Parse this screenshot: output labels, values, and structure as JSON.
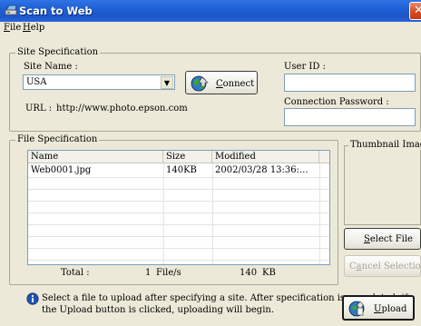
{
  "window": {
    "title": "Scan to Web"
  },
  "menu": [
    {
      "label": "File",
      "accel": "F",
      "rest": "ile"
    },
    {
      "label": "Help",
      "accel": "H",
      "rest": "elp"
    }
  ],
  "site": {
    "group_label": "Site Specification",
    "site_name_label": "Site Name :",
    "site_name_value": "USA",
    "connect_label": "Connect",
    "connect_accel": "C",
    "connect_rest": "onnect",
    "url_label": "URL :",
    "url_value": "http://www.photo.epson.com",
    "user_id_label": "User ID :",
    "password_label": "Connection Password :"
  },
  "files": {
    "group_label": "File Specification",
    "columns": [
      "Name",
      "Size",
      "Modified"
    ],
    "rows": [
      {
        "name": "Web0001.jpg",
        "size": "140KB",
        "modified": "2002/03/28 13:36:..."
      }
    ],
    "total_label": "Total :",
    "total_count": "1",
    "total_unit": "File/s",
    "total_size": "140",
    "total_size_unit": "KB"
  },
  "thumbnail": {
    "label": "Thumbnail Image",
    "select_file_label": "Select File",
    "select_accel": "S",
    "select_rest": "elect File",
    "cancel_selection_label": "Cancel Selection",
    "cancel_accel": "a",
    "cancel_pre": "C",
    "cancel_rest": "ncel Selection"
  },
  "footer": {
    "info_text_line1": "Select a file to upload after specifying a site. After specification is completed, if",
    "info_text_line2": "the Upload button is clicked, uploading will begin.",
    "upload_label": "Upload",
    "upload_accel": "U",
    "upload_rest": "pload"
  },
  "colors": {
    "titlebar": "#1f5fd6",
    "face": "#ece9d8",
    "close": "#d84b22"
  },
  "icons": [
    "app-scanner-icon",
    "close-icon",
    "globe-connect-icon",
    "info-icon",
    "upload-icon",
    "dropdown-arrow-icon"
  ]
}
